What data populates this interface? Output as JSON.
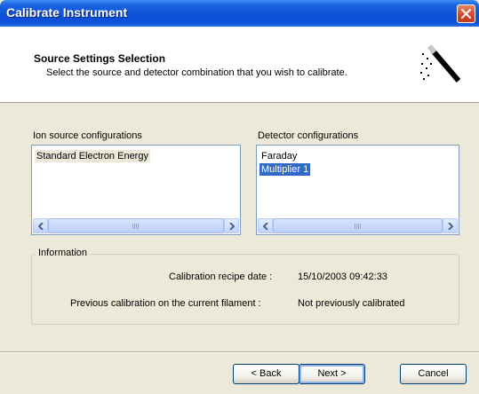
{
  "window": {
    "title": "Calibrate Instrument"
  },
  "header": {
    "title": "Source Settings Selection",
    "subtitle": "Select the source and detector combination that you wish to calibrate."
  },
  "ion_source": {
    "label": "Ion source configurations",
    "items": [
      "Standard Electron Energy"
    ]
  },
  "detector": {
    "label": "Detector configurations",
    "items": [
      "Faraday",
      "Multiplier 1"
    ],
    "selected": "Multiplier 1"
  },
  "information": {
    "legend": "Information",
    "recipe_date_label": "Calibration recipe date :",
    "recipe_date_value": "15/10/2003 09:42:33",
    "previous_label": "Previous calibration on the current filament :",
    "previous_value": "Not previously calibrated"
  },
  "buttons": {
    "back": "< Back",
    "next": "Next >",
    "cancel": "Cancel"
  },
  "icons": {
    "close": "close-icon",
    "wizard": "magic-wand-icon"
  }
}
